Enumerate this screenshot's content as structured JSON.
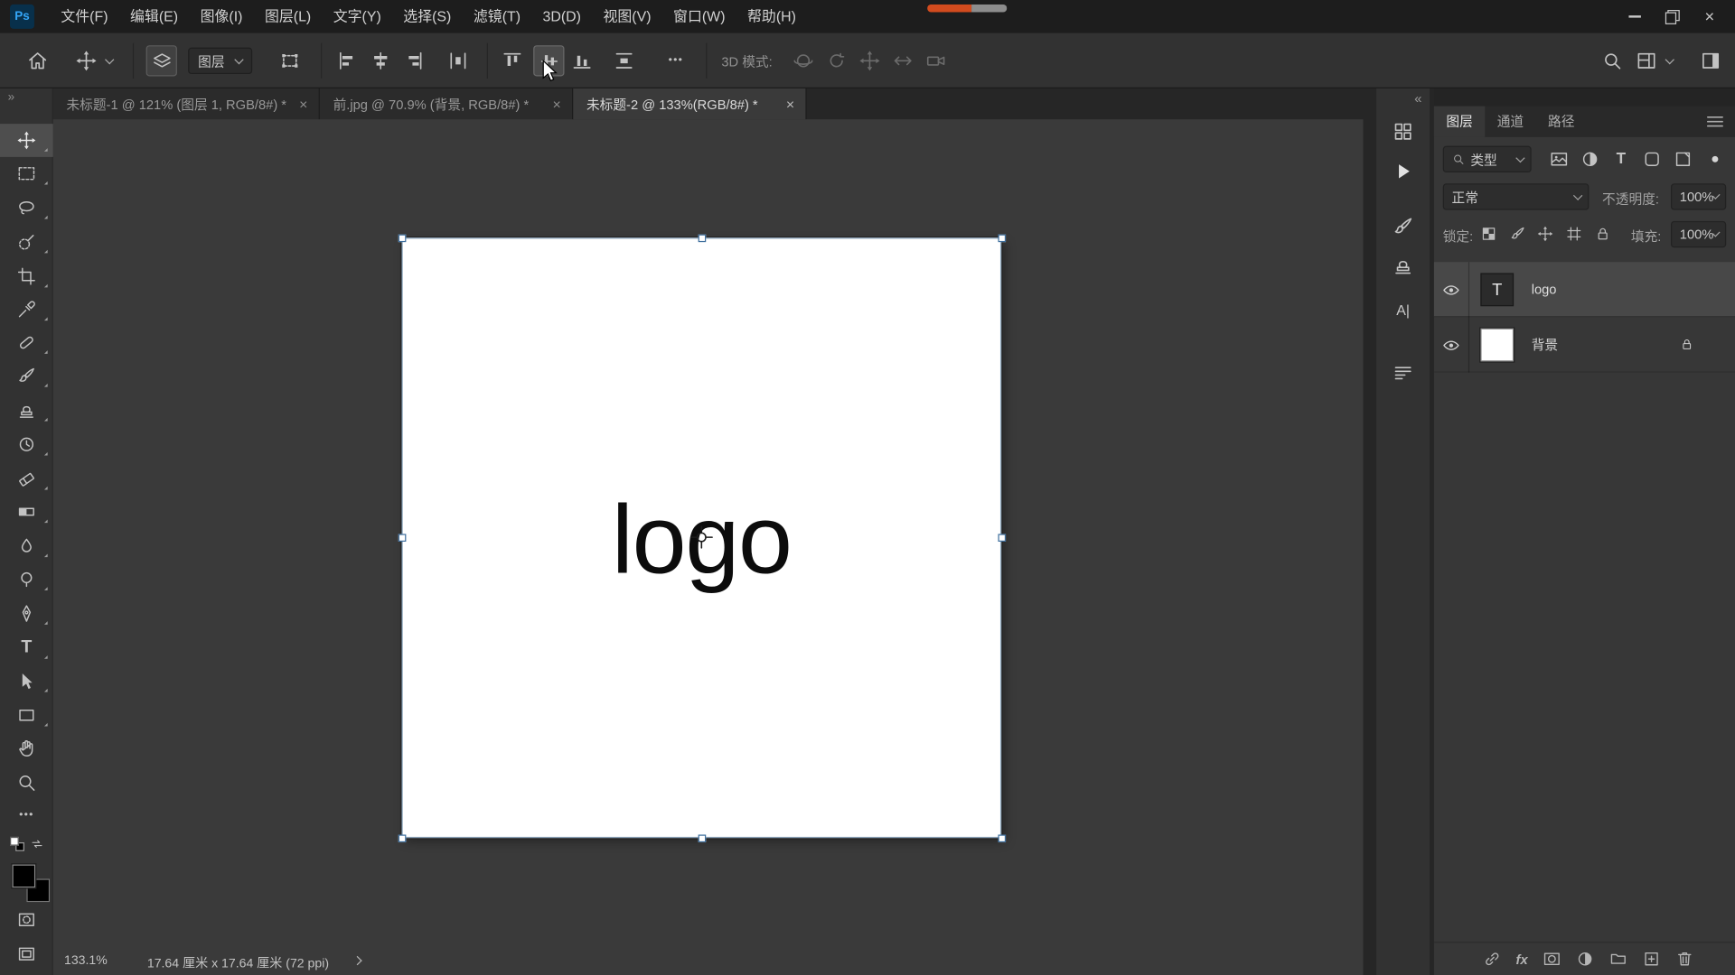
{
  "app": {
    "logo_text": "Ps"
  },
  "menubar": {
    "items": [
      "文件(F)",
      "编辑(E)",
      "图像(I)",
      "图层(L)",
      "文字(Y)",
      "选择(S)",
      "滤镜(T)",
      "3D(D)",
      "视图(V)",
      "窗口(W)",
      "帮助(H)"
    ]
  },
  "window_controls": {
    "close": "×"
  },
  "options_bar": {
    "layer_target": "图层",
    "more": "•••",
    "mode_label": "3D 模式:"
  },
  "toolbar": {
    "collapse": "»",
    "more": "•••",
    "type_tool_glyph": "T"
  },
  "document_tabs": {
    "close_glyph": "×",
    "tabs": [
      {
        "title": "未标题-1 @ 121% (图层 1, RGB/8#) *"
      },
      {
        "title": "前.jpg @ 70.9% (背景, RGB/8#) *"
      },
      {
        "title": "未标题-2 @ 133%(RGB/8#) *"
      }
    ]
  },
  "canvas": {
    "text": "logo"
  },
  "status_bar": {
    "zoom": "133.1%",
    "doc_info": "17.64 厘米 x 17.64 厘米  (72 ppi)"
  },
  "right_rail": {
    "collapse": "«",
    "character_glyph": "A|"
  },
  "layers_panel": {
    "tabs": [
      "图层",
      "通道",
      "路径"
    ],
    "filter_label": "类型",
    "blend_mode": "正常",
    "opacity_label": "不透明度:",
    "opacity_value": "100%",
    "lock_label": "锁定:",
    "fill_label": "填充:",
    "fill_value": "100%",
    "fx_glyph": "fx",
    "layers": [
      {
        "name": "logo",
        "thumb_glyph": "T"
      },
      {
        "name": "背景"
      }
    ]
  },
  "colors": {
    "accent_blue": "#34a6f8",
    "record_orange": "#d24b1e",
    "selection_border": "#8ca6bd",
    "panel_bg": "#373737",
    "pasteboard": "#3a3a3a"
  }
}
